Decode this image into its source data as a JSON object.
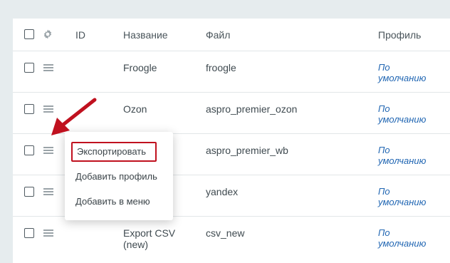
{
  "header": {
    "id": "ID",
    "name": "Название",
    "file": "Файл",
    "profile": "Профиль"
  },
  "rows": [
    {
      "name": "Froogle",
      "file": "froogle",
      "profile": [
        "По",
        "умолчанию"
      ]
    },
    {
      "name": "Ozon",
      "file": "aspro_premier_ozon",
      "profile": [
        "По",
        "умолчанию"
      ]
    },
    {
      "name": "",
      "file": "aspro_premier_wb",
      "profile": [
        "По",
        "умолчанию"
      ]
    },
    {
      "name": "",
      "file": "yandex",
      "profile": [
        "По",
        "умолчанию"
      ]
    },
    {
      "name": [
        "Export CSV",
        "(new)"
      ],
      "file": "csv_new",
      "profile": [
        "По",
        "умолчанию"
      ]
    }
  ],
  "context_menu": {
    "items": [
      "Экспортировать",
      "Добавить профиль",
      "Добавить в меню"
    ]
  },
  "colors": {
    "highlight": "#c0111f",
    "link": "#2267b3",
    "background": "#e6ecee"
  },
  "icons": [
    "gear-icon",
    "drag-handle-icon",
    "arrow-icon"
  ]
}
